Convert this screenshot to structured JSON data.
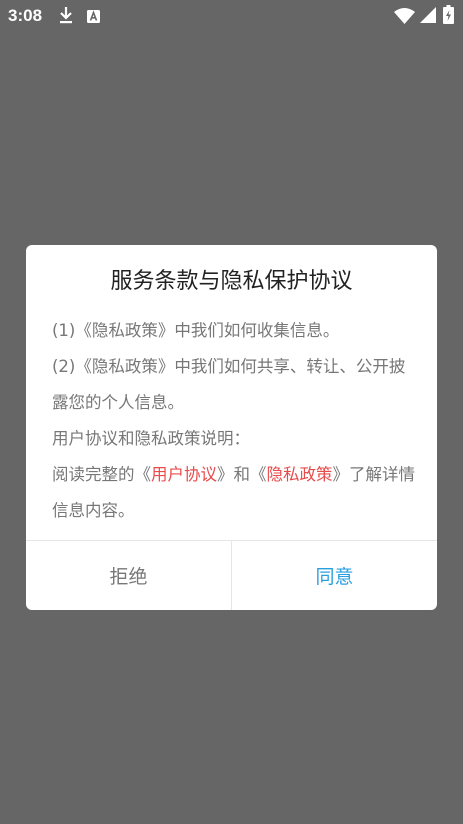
{
  "status_bar": {
    "time": "3:08",
    "icons": [
      "download-icon",
      "a-notification-icon",
      "wifi-icon",
      "signal-icon",
      "battery-charging-icon"
    ]
  },
  "dialog": {
    "title": "服务条款与隐私保护协议",
    "line1": "(1)《隐私政策》中我们如何收集信息。",
    "line2": "(2)《隐私政策》中我们如何共享、转让、公开披露您的个人信息。",
    "line3": "用户协议和隐私政策说明：",
    "line4_prefix": "阅读完整的《",
    "link_user_agreement": "用户协议",
    "line4_mid": "》和《",
    "link_privacy_policy": "隐私政策",
    "line4_suffix": "》了解详情信息内容。",
    "reject_label": "拒绝",
    "agree_label": "同意"
  },
  "colors": {
    "overlay": "#666666",
    "link": "#e84b4b",
    "agree": "#2a9fe0",
    "body_text": "#777777"
  }
}
